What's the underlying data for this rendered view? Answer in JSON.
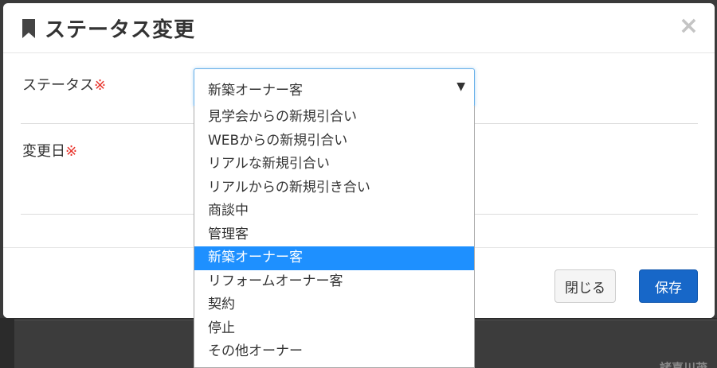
{
  "modal": {
    "title": "ステータス変更",
    "close_symbol": "×"
  },
  "form": {
    "status_label": "ステータス",
    "date_label": "変更日",
    "required_mark": "※",
    "status_select": {
      "value": "新築オーナー客",
      "arrow": "▼",
      "options": [
        "見学会からの新規引合い",
        "WEBからの新規引合い",
        "リアルな新規引合い",
        "リアルからの新規引き合い",
        "商談中",
        "管理客",
        "新築オーナー客",
        "リフォームオーナー客",
        "契約",
        "停止",
        "その他オーナー"
      ]
    }
  },
  "footer": {
    "close_label": "閉じる",
    "save_label": "保存"
  },
  "background": {
    "partial_text": "諸喜川茂"
  },
  "colors": {
    "accent": "#1767c8",
    "required": "#e8332b",
    "selected_option": "#1e90ff"
  }
}
